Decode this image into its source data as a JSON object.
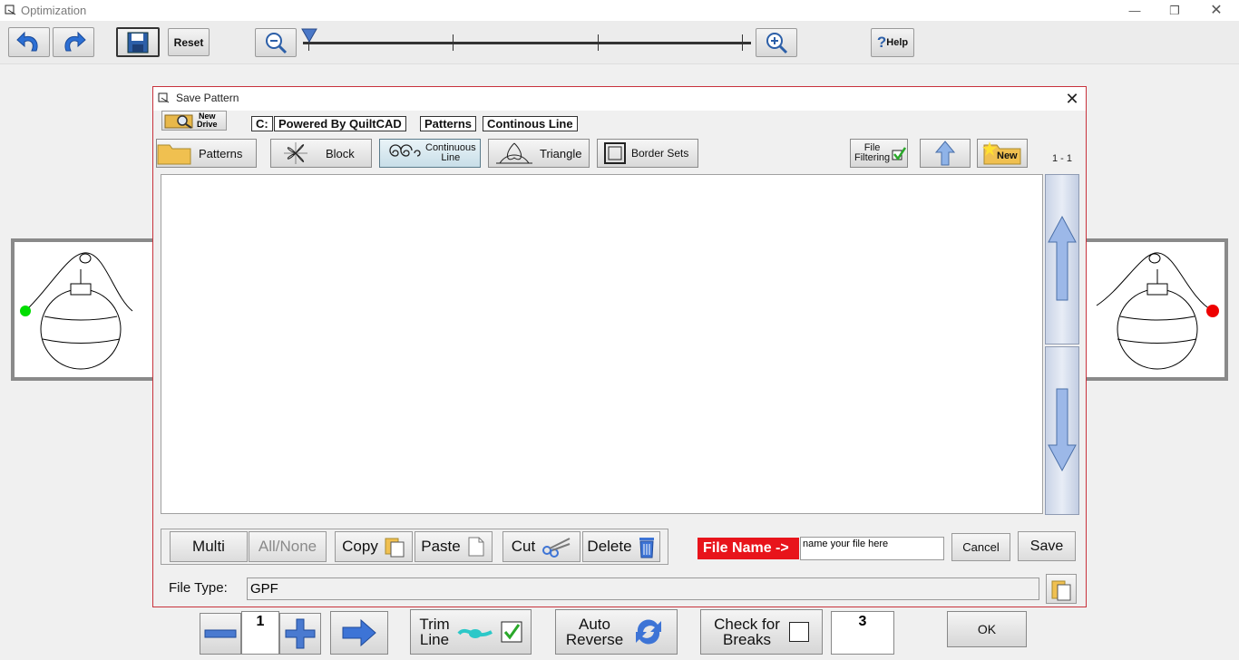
{
  "window": {
    "title": "Optimization"
  },
  "toolbar": {
    "reset_label": "Reset",
    "help_label": "Help",
    "help_prefix": "?"
  },
  "dialog": {
    "title": "Save Pattern",
    "new_drive": [
      "New",
      "Drive"
    ],
    "breadcrumbs": [
      "C:",
      "Powered By QuiltCAD",
      "Patterns",
      "Continous Line"
    ],
    "categories": [
      {
        "label": "Patterns",
        "icon": "folder-icon"
      },
      {
        "label": "Block",
        "icon": "block-icon"
      },
      {
        "label": "Continuous Line",
        "label_line1": "Continuous",
        "label_line2": "Line",
        "icon": "spiral-icon",
        "selected": true
      },
      {
        "label": "Triangle",
        "icon": "triangle-icon"
      },
      {
        "label": "Border Sets",
        "icon": "border-icon"
      }
    ],
    "file_filtering": [
      "File",
      "Filtering"
    ],
    "new_folder_label": "New",
    "page_indicator": "1 - 1",
    "actions": {
      "multi": "Multi",
      "all_none": "All/None",
      "copy": "Copy",
      "paste": "Paste",
      "cut": "Cut",
      "delete": "Delete"
    },
    "file_name_label": "File Name ->",
    "file_name_value": "name your file here",
    "cancel_label": "Cancel",
    "save_label": "Save",
    "file_type_label": "File Type:",
    "file_type_value": "GPF"
  },
  "bottom": {
    "stepper_value": "1",
    "trim_line": [
      "Trim",
      "Line"
    ],
    "auto_reverse": [
      "Auto",
      "Reverse"
    ],
    "check_breaks": [
      "Check for",
      "Breaks"
    ],
    "breaks_value": "3",
    "ok_label": "OK"
  },
  "colors": {
    "accent_red": "#e8141b",
    "dialog_border": "#c8323c",
    "start_dot": "#00dd00",
    "end_dot": "#ee0000"
  }
}
